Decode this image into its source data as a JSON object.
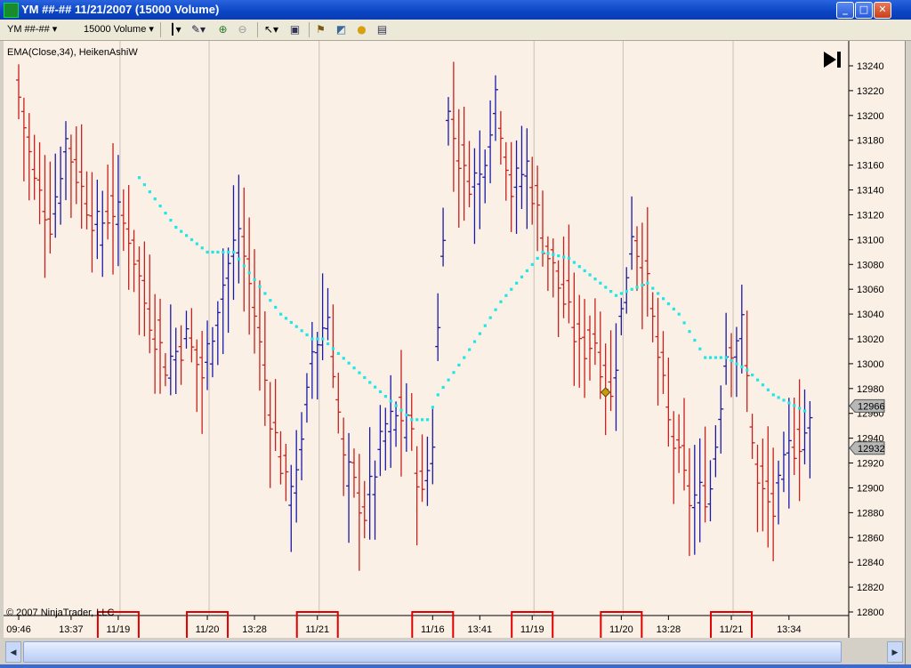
{
  "window": {
    "title": "YM ##-##  11/21/2007 (15000 Volume)",
    "minimize": "_",
    "maximize": "□",
    "close": "✕"
  },
  "toolbar": {
    "instrument": "YM ##-##",
    "interval": "15000 Volume",
    "icons": [
      "bar-type-icon",
      "pencil-icon",
      "zoom-in-icon",
      "zoom-out-icon",
      "cursor-icon",
      "properties-icon",
      "indicators-icon",
      "strategy-icon",
      "data-box-icon"
    ]
  },
  "colors": {
    "background": "#faf0e6",
    "up_bar": "#1a1aa8",
    "down_bar": "#c8201c",
    "ema": "#22e6e6",
    "grid": "#c8c0b8",
    "highlight_box": "#e00000"
  },
  "chart_data": {
    "type": "ohlc_bar",
    "indicator_label": "EMA(Close,34), HeikenAshiW",
    "copyright": "© 2007 NinjaTrader, LLC",
    "y_axis": {
      "ylim": [
        12795,
        13250
      ],
      "ticks": [
        13240,
        13220,
        13200,
        13180,
        13160,
        13140,
        13120,
        13100,
        13080,
        13060,
        13040,
        13020,
        13000,
        12980,
        12960,
        12940,
        12920,
        12900,
        12880,
        12860,
        12840,
        12820,
        12800
      ]
    },
    "x_labels": [
      {
        "bar": 0,
        "text": "09:46",
        "boxed": false
      },
      {
        "bar": 10,
        "text": "13:37",
        "boxed": false
      },
      {
        "bar": 19,
        "text": "11/19",
        "boxed": true
      },
      {
        "bar": 36,
        "text": "11/20",
        "boxed": true
      },
      {
        "bar": 45,
        "text": "13:28",
        "boxed": false
      },
      {
        "bar": 57,
        "text": "11/21",
        "boxed": true
      },
      {
        "bar": 79,
        "text": "11/16",
        "boxed": true
      },
      {
        "bar": 88,
        "text": "13:41",
        "boxed": false
      },
      {
        "bar": 98,
        "text": "11/19",
        "boxed": true
      },
      {
        "bar": 115,
        "text": "11/20",
        "boxed": true
      },
      {
        "bar": 124,
        "text": "13:28",
        "boxed": false
      },
      {
        "bar": 136,
        "text": "11/21",
        "boxed": true
      },
      {
        "bar": 147,
        "text": "13:34",
        "boxed": false
      }
    ],
    "session_breaks": [
      19,
      36,
      57,
      98,
      115,
      136
    ],
    "last_price_tags": [
      {
        "value": 12966,
        "label": "12966",
        "color": "#b8b8b8"
      },
      {
        "value": 12932,
        "label": "12932",
        "color": "#b8b8b8"
      }
    ],
    "marker": {
      "bar": 112,
      "value": 12977
    },
    "waypoints": [
      [
        0,
        13215
      ],
      [
        3,
        13145
      ],
      [
        6,
        13115
      ],
      [
        9,
        13180
      ],
      [
        12,
        13140
      ],
      [
        15,
        13110
      ],
      [
        18,
        13125
      ],
      [
        21,
        13105
      ],
      [
        24,
        13050
      ],
      [
        28,
        13000
      ],
      [
        32,
        13020
      ],
      [
        35,
        12990
      ],
      [
        38,
        13050
      ],
      [
        42,
        13110
      ],
      [
        45,
        13040
      ],
      [
        48,
        12960
      ],
      [
        51,
        12900
      ],
      [
        54,
        12930
      ],
      [
        56,
        13010
      ],
      [
        59,
        13040
      ],
      [
        62,
        12920
      ],
      [
        66,
        12880
      ],
      [
        70,
        12950
      ],
      [
        74,
        12960
      ],
      [
        77,
        12890
      ],
      [
        79,
        12940
      ],
      [
        82,
        13200
      ],
      [
        85,
        13150
      ],
      [
        88,
        13150
      ],
      [
        91,
        13220
      ],
      [
        94,
        13140
      ],
      [
        97,
        13160
      ],
      [
        100,
        13100
      ],
      [
        104,
        13050
      ],
      [
        107,
        13010
      ],
      [
        110,
        13020
      ],
      [
        113,
        12970
      ],
      [
        117,
        13110
      ],
      [
        120,
        13060
      ],
      [
        124,
        12950
      ],
      [
        128,
        12890
      ],
      [
        132,
        12900
      ],
      [
        135,
        13010
      ],
      [
        138,
        13030
      ],
      [
        141,
        12900
      ],
      [
        144,
        12880
      ],
      [
        147,
        12930
      ],
      [
        151,
        12950
      ]
    ],
    "ema_waypoints": [
      [
        23,
        13150
      ],
      [
        30,
        13110
      ],
      [
        36,
        13090
      ],
      [
        41,
        13090
      ],
      [
        50,
        13040
      ],
      [
        56,
        13020
      ],
      [
        58,
        13020
      ],
      [
        67,
        12985
      ],
      [
        75,
        12955
      ],
      [
        78,
        12955
      ],
      [
        80,
        12975
      ],
      [
        85,
        13005
      ],
      [
        92,
        13050
      ],
      [
        97,
        13075
      ],
      [
        100,
        13090
      ],
      [
        105,
        13085
      ],
      [
        111,
        13065
      ],
      [
        114,
        13055
      ],
      [
        120,
        13065
      ],
      [
        126,
        13040
      ],
      [
        131,
        13005
      ],
      [
        135,
        13005
      ],
      [
        139,
        12995
      ],
      [
        144,
        12975
      ],
      [
        150,
        12962
      ]
    ],
    "bar_count": 152,
    "seed": 7
  }
}
